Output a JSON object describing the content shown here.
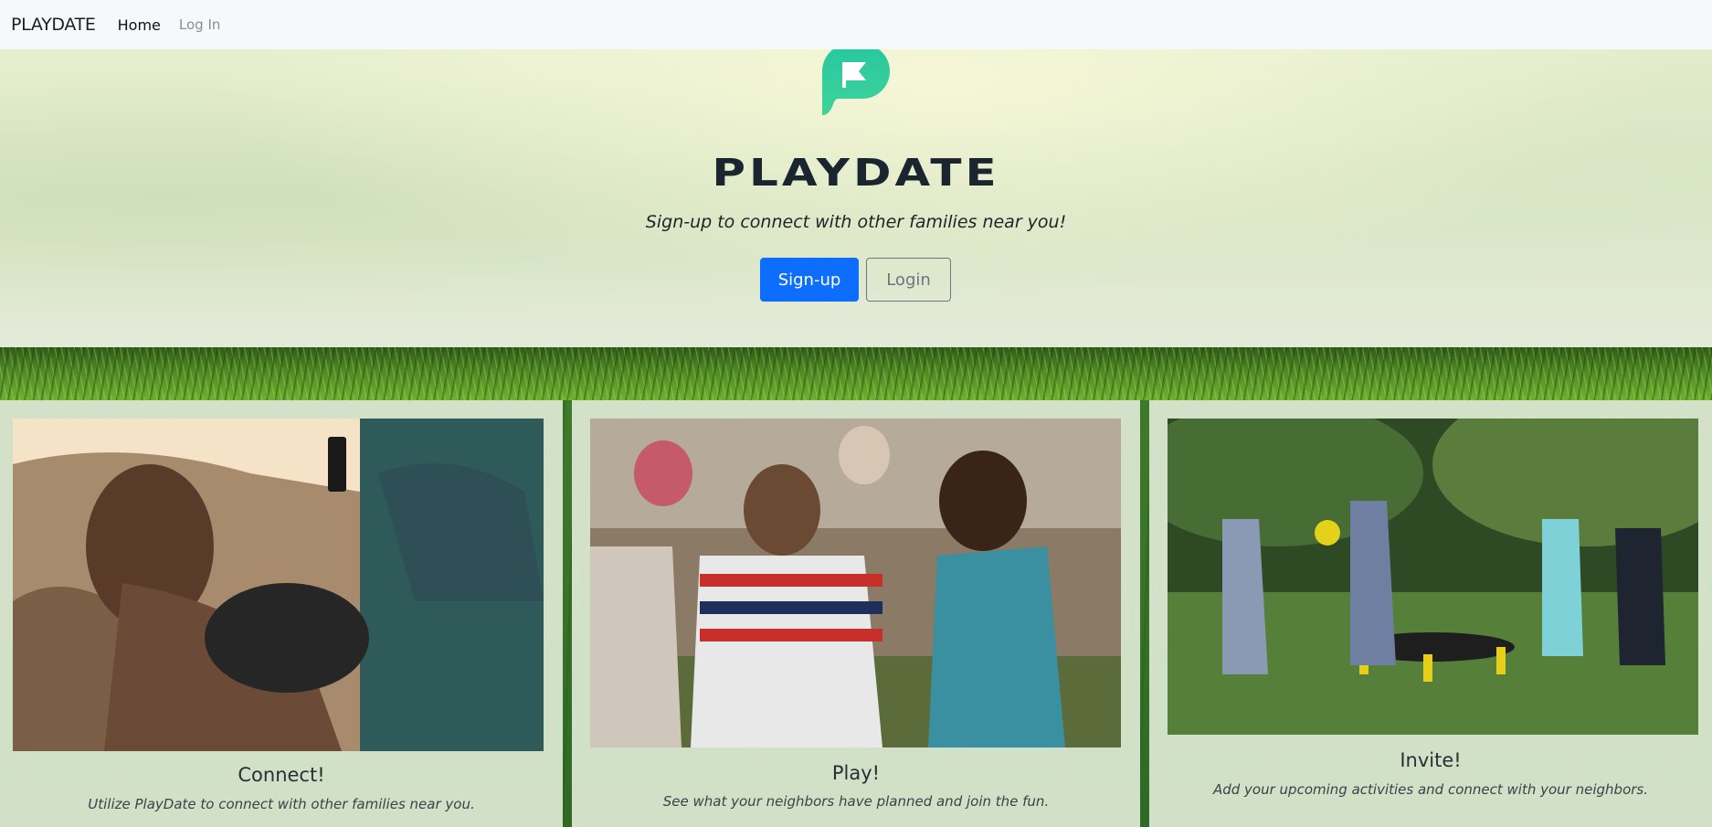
{
  "navbar": {
    "brand": "PLAYDATE",
    "links": [
      {
        "label": "Home"
      },
      {
        "label": "Log In"
      }
    ]
  },
  "hero": {
    "logo_icon": "playdate-flag-logo-icon",
    "wordmark": "PLAYDATE",
    "tagline": "Sign-up to connect with other families near you!",
    "signup_label": "Sign-up",
    "login_label": "Login"
  },
  "cards": [
    {
      "title": "Connect!",
      "text": "Utilize PlayDate to connect with other families near you.",
      "image": "man-on-couch-with-cat-and-phone-photo"
    },
    {
      "title": "Play!",
      "text": "See what your neighbors have planned and join the fun.",
      "image": "children-holding-hands-laughing-photo"
    },
    {
      "title": "Invite!",
      "text": "Add your upcoming activities and connect with your neighbors.",
      "image": "kids-playing-spikeball-on-lawn-photo"
    }
  ],
  "colors": {
    "primary": "#0d6efd",
    "logo_green": "#2fc59a",
    "navbar_bg": "#f6f8fa",
    "wordmark": "#1b2530"
  }
}
